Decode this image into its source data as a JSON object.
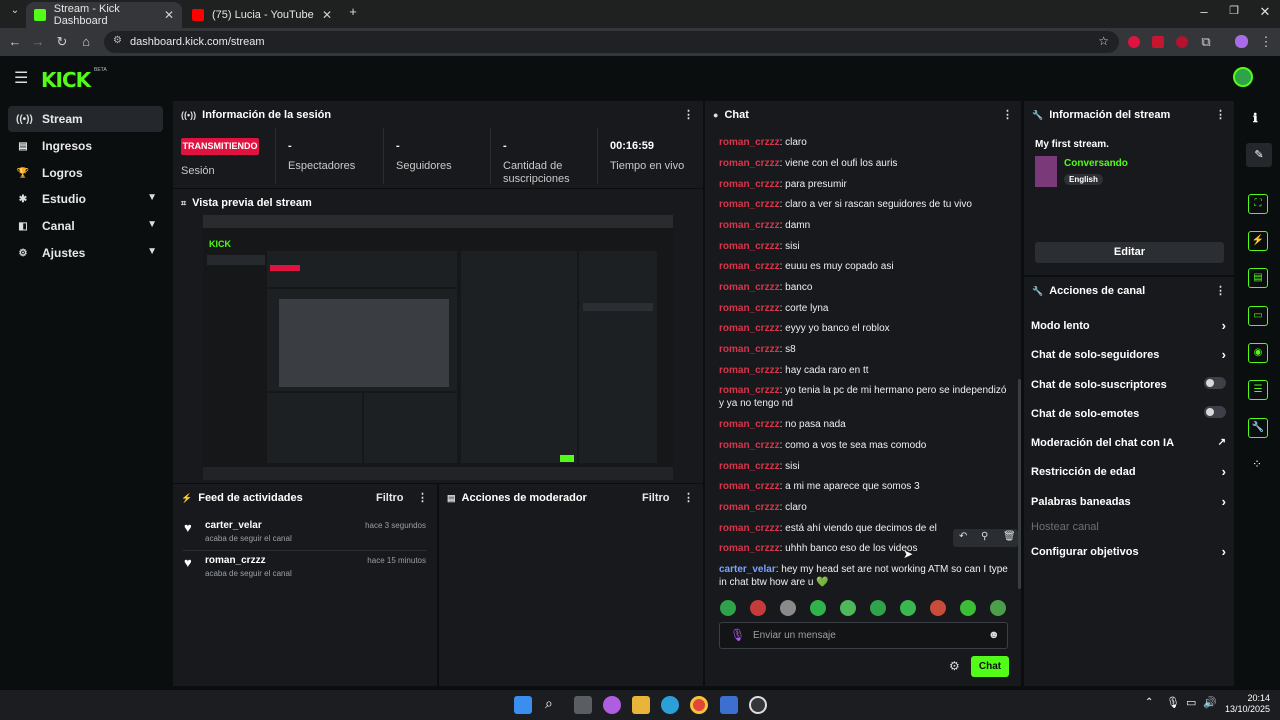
{
  "browser": {
    "tabs": [
      {
        "title": "Stream - Kick Dashboard"
      },
      {
        "title": "(75) Lucia - YouTube"
      }
    ],
    "url": "dashboard.kick.com/stream"
  },
  "app": {
    "logo": "KICK",
    "beta": "BETA"
  },
  "sidebar": {
    "items": [
      {
        "label": "Stream"
      },
      {
        "label": "Ingresos"
      },
      {
        "label": "Logros"
      },
      {
        "label": "Estudio"
      },
      {
        "label": "Canal"
      },
      {
        "label": "Ajustes"
      }
    ]
  },
  "session": {
    "title": "Información de la sesión",
    "badge": "TRANSMITIENDO",
    "badge_label": "Sesión",
    "stats": [
      {
        "value": "-",
        "label": "Espectadores"
      },
      {
        "value": "-",
        "label": "Seguidores"
      },
      {
        "value": "-",
        "label": "Cantidad de suscripciones"
      },
      {
        "value": "00:16:59",
        "label": "Tiempo en vivo"
      }
    ]
  },
  "preview": {
    "title": "Vista previa del stream"
  },
  "feed": {
    "title": "Feed de actividades",
    "filter": "Filtro",
    "items": [
      {
        "user": "carter_velar",
        "action": "acaba de seguir el canal",
        "time": "hace 3 segundos"
      },
      {
        "user": "roman_crzzz",
        "action": "acaba de seguir el canal",
        "time": "hace 15 minutos"
      }
    ]
  },
  "mod": {
    "title": "Acciones de moderador",
    "filter": "Filtro"
  },
  "chat": {
    "title": "Chat",
    "messages": [
      {
        "user": "roman_crzzz",
        "text": ": claro"
      },
      {
        "user": "roman_crzzz",
        "text": ": viene con el oufi los auris"
      },
      {
        "user": "roman_crzzz",
        "text": ": para presumir"
      },
      {
        "user": "roman_crzzz",
        "text": ": claro a ver si rascan seguidores de tu vivo"
      },
      {
        "user": "roman_crzzz",
        "text": ": damn"
      },
      {
        "user": "roman_crzzz",
        "text": ": sisi"
      },
      {
        "user": "roman_crzzz",
        "text": ": euuu es muy copado asi"
      },
      {
        "user": "roman_crzzz",
        "text": ": banco"
      },
      {
        "user": "roman_crzzz",
        "text": ": corte lyna"
      },
      {
        "user": "roman_crzzz",
        "text": ": eyyy yo banco el roblox"
      },
      {
        "user": "roman_crzzz",
        "text": ": s8"
      },
      {
        "user": "roman_crzzz",
        "text": ": hay cada raro en tt"
      },
      {
        "user": "roman_crzzz",
        "text": ": yo tenia la pc de mi hermano pero se independizó y ya no tengo nd"
      },
      {
        "user": "roman_crzzz",
        "text": ": no pasa nada"
      },
      {
        "user": "roman_crzzz",
        "text": ": como a vos te sea mas comodo"
      },
      {
        "user": "roman_crzzz",
        "text": ": sisi"
      },
      {
        "user": "roman_crzzz",
        "text": ": a mi me aparece que somos 3"
      },
      {
        "user": "roman_crzzz",
        "text": ": claro"
      },
      {
        "user": "roman_crzzz",
        "text": ": está ahí viendo que decimos de el"
      },
      {
        "user": "roman_crzzz",
        "text": ": uhhh banco eso de los videos"
      },
      {
        "user": "carter_velar",
        "text": ": hey my head set are not working ATM so can I type in chat btw how are u 💚"
      }
    ],
    "input_placeholder": "Enviar un mensaje",
    "send_label": "Chat"
  },
  "stream_info": {
    "title": "Información del stream",
    "stream_title": "My first stream.",
    "category": "Conversando",
    "language": "English",
    "edit_label": "Editar"
  },
  "channel_actions": {
    "title": "Acciones de canal",
    "items": [
      {
        "label": "Modo lento"
      },
      {
        "label": "Chat de solo-seguidores"
      },
      {
        "label": "Chat de solo-suscriptores"
      },
      {
        "label": "Chat de solo-emotes"
      },
      {
        "label": "Moderación del chat con IA"
      },
      {
        "label": "Restricción de edad"
      },
      {
        "label": "Palabras baneadas"
      },
      {
        "label": "Hostear canal"
      },
      {
        "label": "Configurar objetivos"
      }
    ]
  },
  "taskbar": {
    "time": "20:14",
    "date": "13/10/2025"
  },
  "colors": {
    "accent": "#53fc18",
    "live": "#e0123f",
    "username": "#d9344b"
  }
}
